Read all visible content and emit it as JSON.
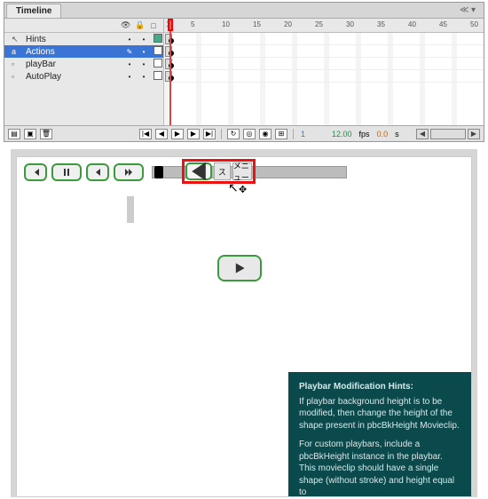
{
  "panel": {
    "tab": "Timeline"
  },
  "layerHeader": {
    "eye": "👁",
    "lock": "🔒",
    "outline": "□"
  },
  "layers": [
    {
      "name": "Hints",
      "icon": "↖",
      "sel": false,
      "sq": "g"
    },
    {
      "name": "Actions",
      "icon": "a",
      "sel": true,
      "sq": "w"
    },
    {
      "name": "playBar",
      "icon": "▫",
      "sel": false,
      "sq": "w"
    },
    {
      "name": "AutoPlay",
      "icon": "▫",
      "sel": false,
      "sq": "w"
    }
  ],
  "ruler": {
    "marks": [
      1,
      5,
      10,
      15,
      20,
      25,
      30,
      35,
      40,
      45,
      50
    ]
  },
  "footer": {
    "frame": "1",
    "fps_val": "12.00",
    "fps_lbl": "fps",
    "time_val": "0.0",
    "time_lbl": "s"
  },
  "playbar": {
    "back_lbl": "ス",
    "menu_lbl": "メニュー"
  },
  "hints": {
    "title": "Playbar Modification Hints:",
    "p1": "If playbar background height is to be modified, then change the height of the shape present in pbcBkHeight Movieclip.",
    "p2": "For custom playbars, include a pbcBkHeight instance in the playbar. This movieclip should have a single shape (without stroke) and height equal to"
  }
}
